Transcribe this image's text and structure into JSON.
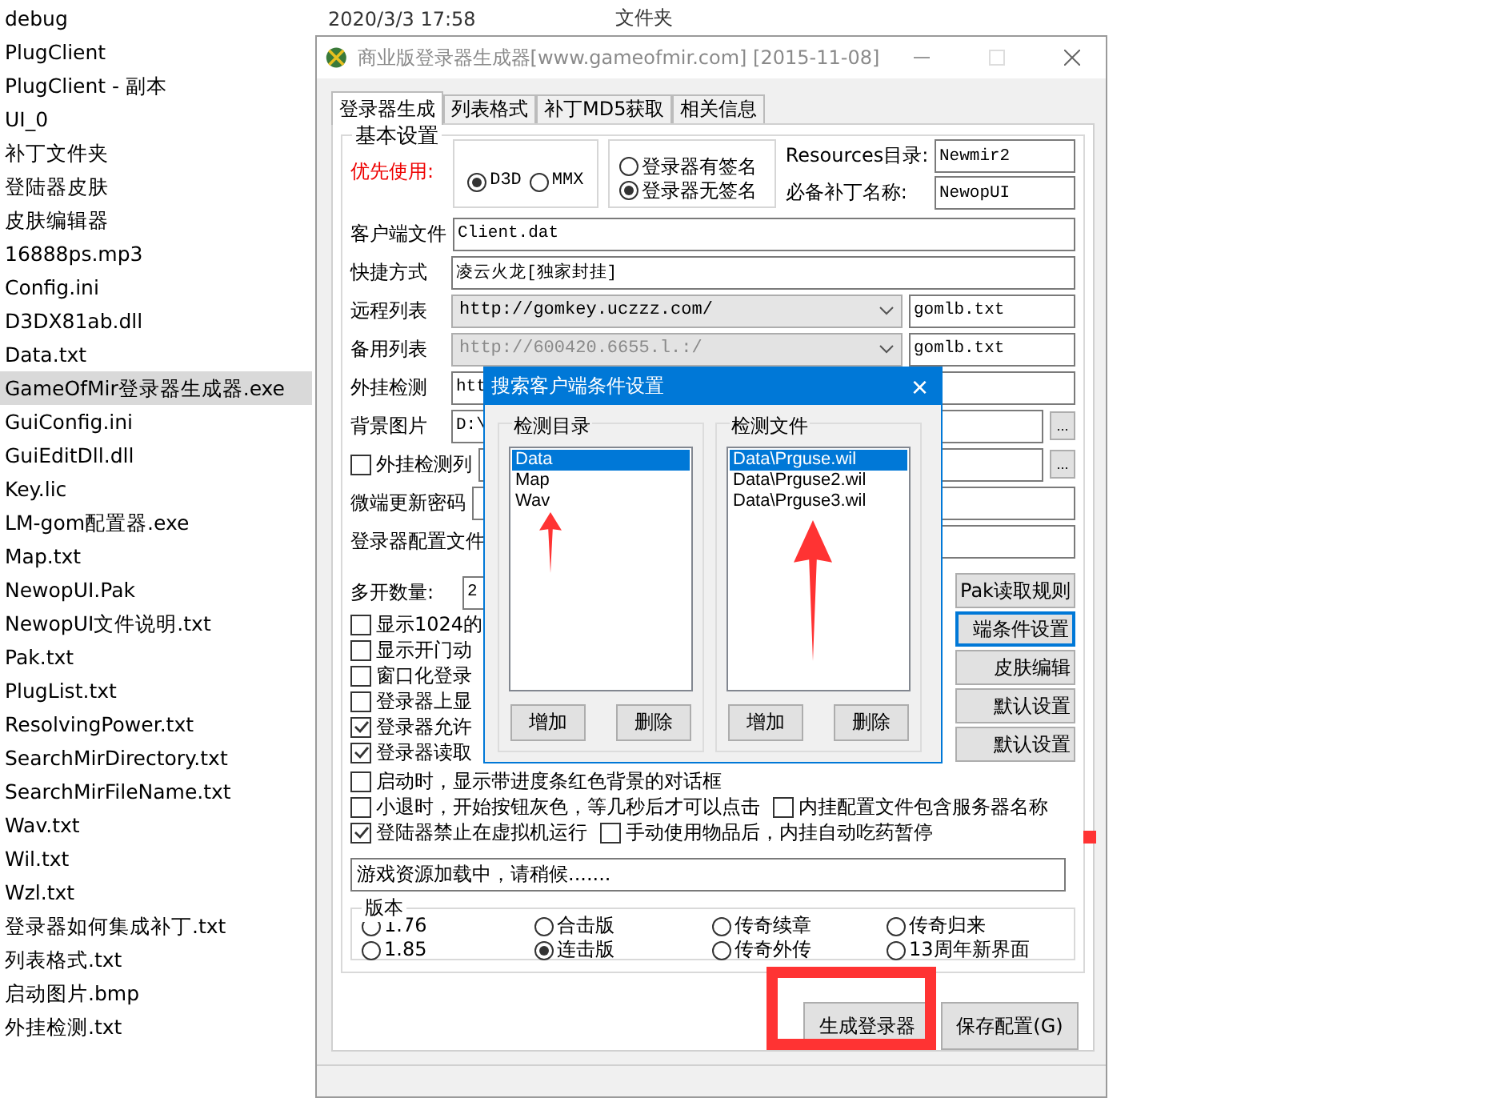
{
  "explorer": {
    "header": {
      "date": "2020/3/3 17:58",
      "type": "文件夹"
    },
    "files": [
      {
        "name": "debug",
        "selected": false
      },
      {
        "name": "PlugClient",
        "selected": false
      },
      {
        "name": "PlugClient - 副本",
        "selected": false
      },
      {
        "name": "UI_0",
        "selected": false
      },
      {
        "name": "补丁文件夹",
        "selected": false
      },
      {
        "name": "登陆器皮肤",
        "selected": false
      },
      {
        "name": "皮肤编辑器",
        "selected": false
      },
      {
        "name": "16888ps.mp3",
        "selected": false
      },
      {
        "name": "Config.ini",
        "selected": false
      },
      {
        "name": "D3DX81ab.dll",
        "selected": false
      },
      {
        "name": "Data.txt",
        "selected": false
      },
      {
        "name": "GameOfMir登录器生成器.exe",
        "selected": true
      },
      {
        "name": "GuiConfig.ini",
        "selected": false
      },
      {
        "name": "GuiEditDll.dll",
        "selected": false
      },
      {
        "name": "Key.lic",
        "selected": false
      },
      {
        "name": "LM-gom配置器.exe",
        "selected": false
      },
      {
        "name": "Map.txt",
        "selected": false
      },
      {
        "name": "NewopUI.Pak",
        "selected": false
      },
      {
        "name": "NewopUI文件说明.txt",
        "selected": false
      },
      {
        "name": "Pak.txt",
        "selected": false
      },
      {
        "name": "PlugList.txt",
        "selected": false
      },
      {
        "name": "ResolvingPower.txt",
        "selected": false
      },
      {
        "name": "SearchMirDirectory.txt",
        "selected": false
      },
      {
        "name": "SearchMirFileName.txt",
        "selected": false
      },
      {
        "name": "Wav.txt",
        "selected": false
      },
      {
        "name": "Wil.txt",
        "selected": false
      },
      {
        "name": "Wzl.txt",
        "selected": false
      },
      {
        "name": "登录器如何集成补丁.txt",
        "selected": false
      },
      {
        "name": "列表格式.txt",
        "selected": false
      },
      {
        "name": "启动图片.bmp",
        "selected": false
      },
      {
        "name": "外挂检测.txt",
        "selected": false
      }
    ]
  },
  "window": {
    "title": "商业版登录器生成器[www.gameofmir.com] [2015-11-08]",
    "tabs": [
      {
        "label": "登录器生成",
        "selected": true
      },
      {
        "label": "列表格式",
        "selected": false
      },
      {
        "label": "补丁MD5获取",
        "selected": false
      },
      {
        "label": "相关信息",
        "selected": false
      }
    ],
    "basic": {
      "title": "基本设置",
      "priority_label": "优先使用:",
      "render_options": [
        {
          "label": "D3D",
          "selected": true
        },
        {
          "label": "MMX",
          "selected": false
        }
      ],
      "sign_options": [
        {
          "label": "登录器有签名",
          "selected": false
        },
        {
          "label": "登录器无签名",
          "selected": true
        }
      ],
      "resources_label": "Resources目录:",
      "resources_value": "Newmir2",
      "patch_label": "必备补丁名称:",
      "patch_value": "NewopUI",
      "fields": [
        {
          "kind": "text",
          "label": "客户端文件",
          "value": "Client.dat"
        },
        {
          "kind": "text",
          "label": "快捷方式",
          "value": "凌云火龙[独家封挂]"
        },
        {
          "kind": "combo",
          "label": "远程列表",
          "value": "http://gomkey.uczzz.com/",
          "extra": "gomlb.txt",
          "disabled": false
        },
        {
          "kind": "combo",
          "label": "备用列表",
          "value": "http://600420.6655.l.:/",
          "extra": "gomlb.txt",
          "disabled": true
        },
        {
          "kind": "text",
          "label": "外挂检测",
          "value": "htt"
        },
        {
          "kind": "browse",
          "label": "背景图片",
          "value": "D:\\",
          "button": "..."
        },
        {
          "kind": "check_browse",
          "label": "外挂检测列",
          "checked": false,
          "button": "..."
        },
        {
          "kind": "text",
          "label": "微端更新密码"
        },
        {
          "kind": "text",
          "label": "登录器配置文件"
        }
      ],
      "count_label": "多开数量:",
      "count_value": "2",
      "side_buttons": [
        {
          "label": "Pak读取规则",
          "focused": false
        },
        {
          "label": "端条件设置",
          "focused": true
        },
        {
          "label": "皮肤编辑",
          "focused": false
        },
        {
          "label": "默认设置",
          "focused": false
        },
        {
          "label": "默认设置",
          "focused": false
        }
      ],
      "short_options": [
        {
          "label": "显示1024的",
          "checked": false
        },
        {
          "label": "显示开门动",
          "checked": false
        },
        {
          "label": "窗口化登录",
          "checked": false
        },
        {
          "label": "登录器上显",
          "checked": false
        },
        {
          "label": "登录器允许",
          "checked": true
        },
        {
          "label": "登录器读取",
          "checked": true
        }
      ],
      "options": [
        [
          {
            "label": "启动时，显示带进度条红色背景的对话框",
            "checked": false
          }
        ],
        [
          {
            "label": "小退时，开始按钮灰色，等几秒后才可以点击",
            "checked": false
          },
          {
            "label": "内挂配置文件包含服务器名称",
            "checked": false
          }
        ],
        [
          {
            "label": "登陆器禁止在虚拟机运行",
            "checked": true
          },
          {
            "label": "手动使用物品后，内挂自动吃药暂停",
            "checked": false
          }
        ]
      ],
      "loading_text": "游戏资源加载中，请稍候.......",
      "version": {
        "title": "版本",
        "options": [
          {
            "label": "1.76",
            "selected": false
          },
          {
            "label": "合击版",
            "selected": false
          },
          {
            "label": "传奇续章",
            "selected": false
          },
          {
            "label": "传奇归来",
            "selected": false
          },
          {
            "label": "1.85",
            "selected": false
          },
          {
            "label": "连击版",
            "selected": true
          },
          {
            "label": "传奇外传",
            "selected": false
          },
          {
            "label": "13周年新界面",
            "selected": false
          }
        ]
      }
    },
    "buttons": [
      {
        "label": "生成登录器",
        "highlighted": true
      },
      {
        "label": "保存配置(G)",
        "highlighted": false
      }
    ]
  },
  "dialog": {
    "title": "搜索客户端条件设置",
    "close": "×",
    "panels": [
      {
        "title": "检测目录",
        "items": [
          {
            "label": "Data",
            "selected": true
          },
          {
            "label": "Map",
            "selected": false
          },
          {
            "label": "Wav",
            "selected": false
          }
        ],
        "buttons": [
          "增加",
          "删除"
        ]
      },
      {
        "title": "检测文件",
        "items": [
          {
            "label": "Data\\Prguse.wil",
            "selected": true
          },
          {
            "label": "Data\\Prguse2.wil",
            "selected": false
          },
          {
            "label": "Data\\Prguse3.wil",
            "selected": false
          }
        ],
        "buttons": [
          "增加",
          "删除"
        ]
      }
    ]
  }
}
